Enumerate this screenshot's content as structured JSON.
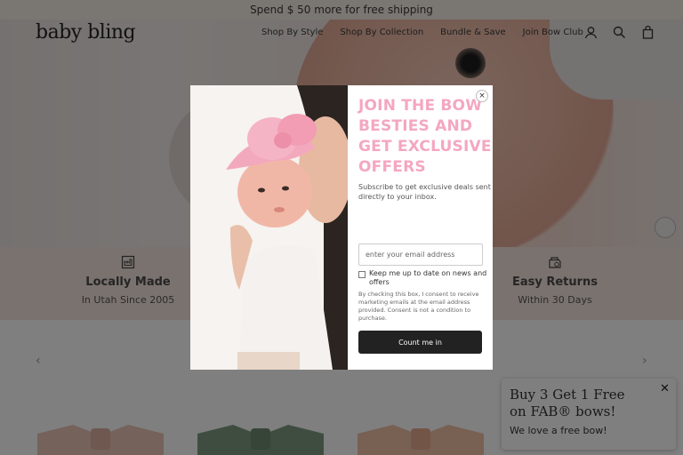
{
  "announcement": "Spend $ 50 more for free shipping",
  "header": {
    "logo": "baby bling",
    "nav": [
      "Shop By Style",
      "Shop By Collection",
      "Bundle & Save",
      "Join Bow Club"
    ],
    "icons": [
      "account-icon",
      "search-icon",
      "cart-icon"
    ]
  },
  "features": [
    {
      "title": "Locally Made",
      "subtitle": "In Utah Since 2005",
      "icon": "factory-icon"
    },
    {
      "title": "Easy Returns",
      "subtitle": "Within 30 Days",
      "icon": "return-icon"
    }
  ],
  "modal": {
    "title": "JOIN THE BOW BESTIES AND GET EXCLUSIVE OFFERS",
    "subtitle": "Subscribe to get exclusive deals sent directly to your inbox.",
    "email_placeholder": "enter your email address",
    "checkbox_label": "Keep me up to date on news and offers",
    "consent": "By checking this box, I consent to receive marketing emails at the email address provided. Consent is not a condition to purchase.",
    "submit_label": "Count me in",
    "close_label": "×"
  },
  "promo": {
    "title": "Buy 3 Get 1 Free on FAB® bows!",
    "subtitle": "We love a free bow!",
    "close_label": "✕"
  },
  "carousel": {
    "prev": "‹",
    "next": "›"
  },
  "colors": {
    "accent": "#f4a7c0",
    "button": "#222222",
    "feature_bg": "#f5e5dd"
  }
}
